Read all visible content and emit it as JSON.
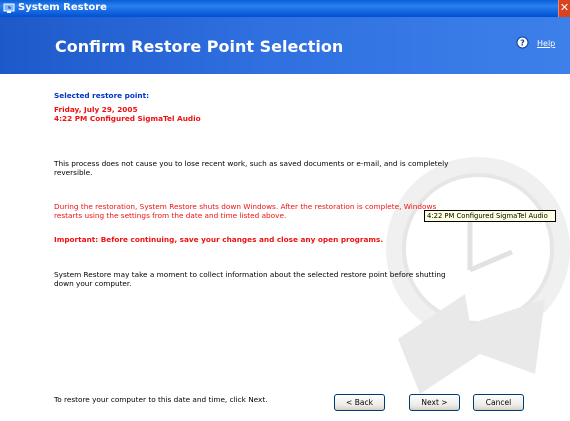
{
  "window": {
    "title": "System Restore"
  },
  "header": {
    "page_title": "Confirm Restore Point Selection",
    "help_label": "Help"
  },
  "restore_point": {
    "label": "Selected restore point:",
    "date": "Friday, July 29, 2005",
    "description": "4:22 PM Configured SigmaTel Audio"
  },
  "tooltip": {
    "text": "4:22 PM Configured SigmaTel Audio"
  },
  "messages": {
    "p1_line1": "This process does not cause you to lose recent work, such as saved documents or e-mail, and is completely",
    "p1_line2": "reversible.",
    "p2_line1": "During the restoration, System Restore shuts down Windows. After the restoration is complete, Windows",
    "p2_line2": "restarts using the settings from the date and time listed above.",
    "p3": "Important: Before continuing, save your changes and close any open programs.",
    "p4_line1": "System Restore may take a moment to collect information about the selected restore point before shutting",
    "p4_line2": "down your computer.",
    "footer": "To restore your computer to this date and time, click Next."
  },
  "buttons": {
    "back": "< Back",
    "next": "Next >",
    "cancel": "Cancel"
  },
  "colors": {
    "titlebar": "#0a5fd6",
    "header": "#2f6fe0",
    "warning_text": "#ee1111",
    "label_text": "#0033cc",
    "tooltip_bg": "#ffffe1"
  }
}
